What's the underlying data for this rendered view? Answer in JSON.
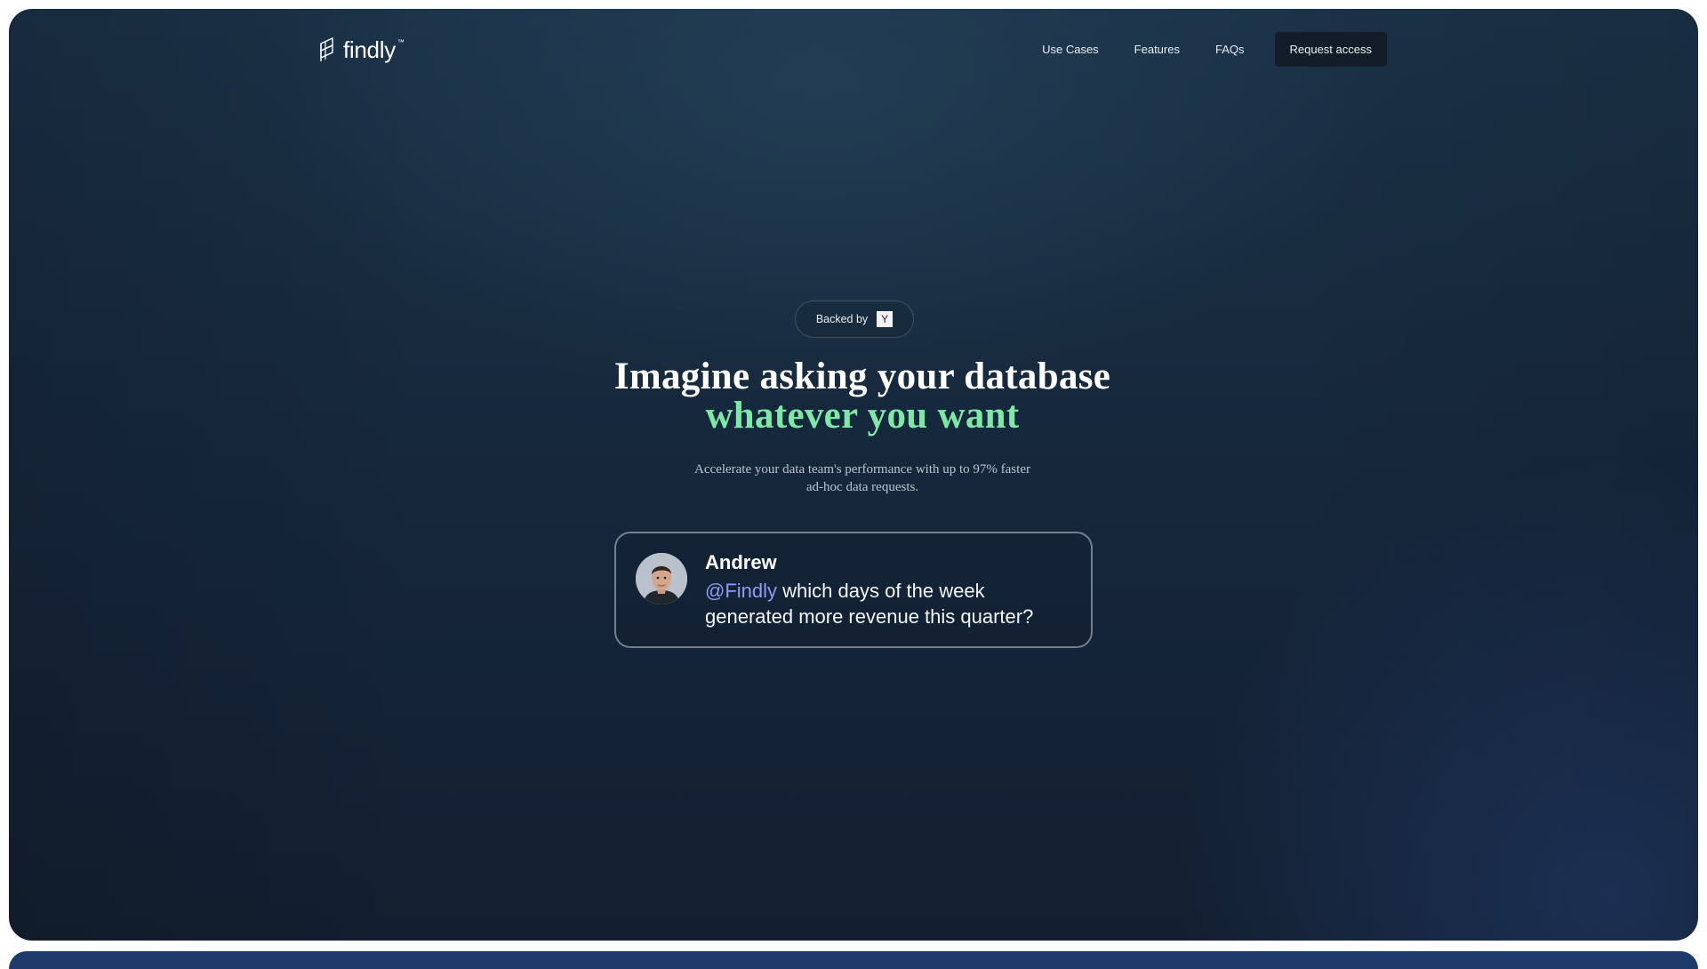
{
  "nav": {
    "logo_text": "findly",
    "logo_tm": "™",
    "links": [
      "Use Cases",
      "Features",
      "FAQs"
    ],
    "cta": "Request access"
  },
  "hero": {
    "badge_label": "Backed by",
    "badge_logo": "Y",
    "headline_line1": "Imagine asking your database",
    "headline_line2": "whatever you want",
    "subtitle": "Accelerate your data team's performance with up to 97% faster ad-hoc data requests."
  },
  "card": {
    "name": "Andrew",
    "mention": "@Findly",
    "message": " which days of the week generated more revenue this quarter?"
  },
  "colors": {
    "accent_green": "#7ee8a6",
    "mention_blue": "#8c9cf7",
    "background": "#172a3e"
  }
}
